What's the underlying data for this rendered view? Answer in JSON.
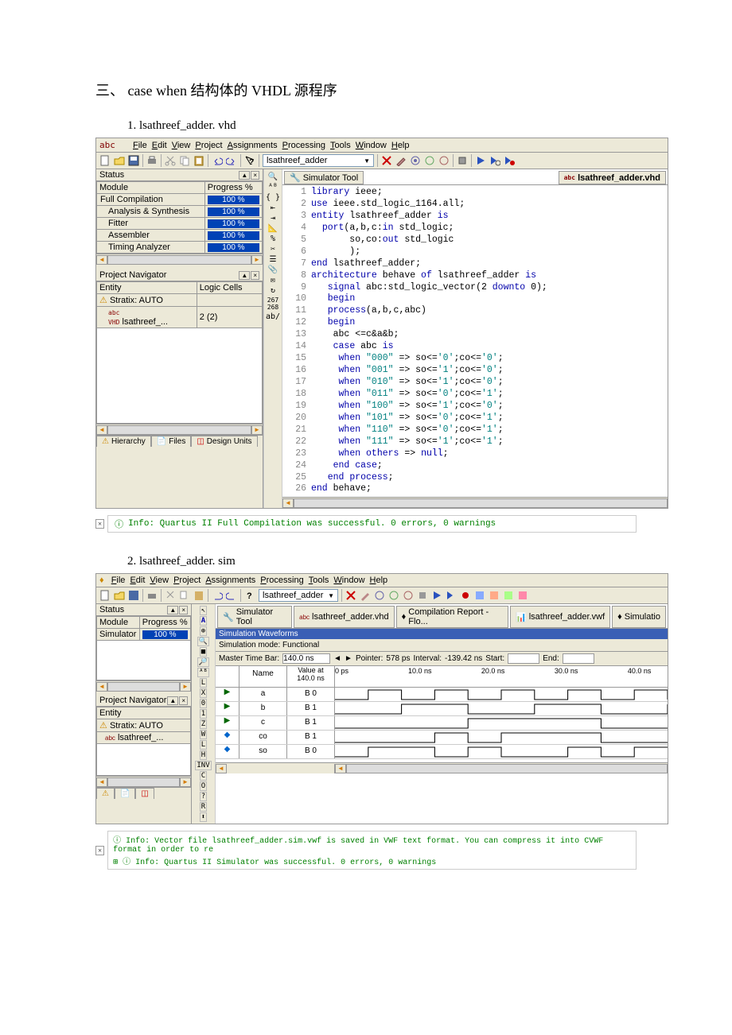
{
  "heading": "三、 case when 结构体的 VHDL 源程序",
  "item1_title": "1.   lsathreef_adder. vhd",
  "item2_title": "2.   lsathreef_adder. sim",
  "menus": [
    "File",
    "Edit",
    "View",
    "Project",
    "Assignments",
    "Processing",
    "Tools",
    "Window",
    "Help"
  ],
  "project_name": "lsathreef_adder",
  "status": {
    "title": "Status",
    "cols": [
      "Module",
      "Progress %"
    ],
    "rows": [
      {
        "name": "Full Compilation",
        "pct": "100 %"
      },
      {
        "name": "Analysis & Synthesis",
        "pct": "100 %"
      },
      {
        "name": "Fitter",
        "pct": "100 %"
      },
      {
        "name": "Assembler",
        "pct": "100 %"
      },
      {
        "name": "Timing Analyzer",
        "pct": "100 %"
      }
    ]
  },
  "nav": {
    "title": "Project Navigator",
    "cols": [
      "Entity",
      "Logic Cells"
    ],
    "rows": [
      {
        "name": "Stratix: AUTO",
        "val": ""
      },
      {
        "name": "lsathreef_...",
        "val": "2 (2)"
      }
    ],
    "tabs": [
      "Hierarchy",
      "Files",
      "Design Units"
    ]
  },
  "doc_tabs": {
    "sim": "Simulator Tool",
    "vhd": "lsathreef_adder.vhd",
    "vwf": "lsathreef_adder.vwf",
    "compile": "Compilation Report - Flo...",
    "simrep": "Simulatio"
  },
  "code_lines": [
    {
      "n": 1,
      "t": "library ieee;",
      "k": [
        "library"
      ]
    },
    {
      "n": 2,
      "t": "use ieee.std_logic_1164.all;",
      "k": [
        "use"
      ]
    },
    {
      "n": 3,
      "t": "entity lsathreef_adder is",
      "k": [
        "entity",
        "is"
      ]
    },
    {
      "n": 4,
      "t": "  port(a,b,c:in std_logic;",
      "k": [
        "port",
        "in"
      ]
    },
    {
      "n": 5,
      "t": "       so,co:out std_logic",
      "k": [
        "out"
      ]
    },
    {
      "n": 6,
      "t": "       );"
    },
    {
      "n": 7,
      "t": "end lsathreef_adder;",
      "k": [
        "end"
      ]
    },
    {
      "n": 8,
      "t": "architecture behave of lsathreef_adder is",
      "k": [
        "architecture",
        "of",
        "is"
      ]
    },
    {
      "n": 9,
      "t": "   signal abc:std_logic_vector(2 downto 0);",
      "k": [
        "signal",
        "downto"
      ]
    },
    {
      "n": 10,
      "t": "   begin",
      "k": [
        "begin"
      ]
    },
    {
      "n": 11,
      "t": "   process(a,b,c,abc)",
      "k": [
        "process"
      ]
    },
    {
      "n": 12,
      "t": "   begin",
      "k": [
        "begin"
      ]
    },
    {
      "n": 13,
      "t": "    abc <=c&a&b;"
    },
    {
      "n": 14,
      "t": "    case abc is",
      "k": [
        "case",
        "is"
      ]
    },
    {
      "n": 15,
      "t": "     when \"000\" => so<='0';co<='0';",
      "k": [
        "when"
      ]
    },
    {
      "n": 16,
      "t": "     when \"001\" => so<='1';co<='0';",
      "k": [
        "when"
      ]
    },
    {
      "n": 17,
      "t": "     when \"010\" => so<='1';co<='0';",
      "k": [
        "when"
      ]
    },
    {
      "n": 18,
      "t": "     when \"011\" => so<='0';co<='1';",
      "k": [
        "when"
      ]
    },
    {
      "n": 19,
      "t": "     when \"100\" => so<='1';co<='0';",
      "k": [
        "when"
      ]
    },
    {
      "n": 20,
      "t": "     when \"101\" => so<='0';co<='1';",
      "k": [
        "when"
      ]
    },
    {
      "n": 21,
      "t": "     when \"110\" => so<='0';co<='1';",
      "k": [
        "when"
      ]
    },
    {
      "n": 22,
      "t": "     when \"111\" => so<='1';co<='1';",
      "k": [
        "when"
      ]
    },
    {
      "n": 23,
      "t": "     when others => null;",
      "k": [
        "when",
        "others",
        "null"
      ]
    },
    {
      "n": 24,
      "t": "    end case;",
      "k": [
        "end",
        "case"
      ]
    },
    {
      "n": 25,
      "t": "   end process;",
      "k": [
        "end",
        "process"
      ]
    },
    {
      "n": 26,
      "t": "end behave;",
      "k": [
        "end"
      ]
    }
  ],
  "info_msg": "Info: Quartus II Full Compilation was successful. 0 errors, 0 warnings",
  "sim": {
    "status_rows": [
      {
        "name": "Simulator",
        "pct": "100 %"
      }
    ],
    "waveform_title": "Simulation Waveforms",
    "mode": "Simulation mode: Functional",
    "timebar": {
      "label": "Master Time Bar:",
      "value": "140.0 ns",
      "pointer_label": "Pointer:",
      "pointer": "578 ps",
      "interval_label": "Interval:",
      "interval": "-139.42 ns",
      "start_label": "Start:",
      "end_label": "End:"
    },
    "val_header": {
      "name": "Name",
      "value": "Value at\n140.0 ns"
    },
    "ticks": [
      "0 ps",
      "10.0 ns",
      "20.0 ns",
      "30.0 ns",
      "40.0 ns"
    ],
    "signals": [
      {
        "name": "a",
        "val": "B 0"
      },
      {
        "name": "b",
        "val": "B 1"
      },
      {
        "name": "c",
        "val": "B 1"
      },
      {
        "name": "co",
        "val": "B 1"
      },
      {
        "name": "so",
        "val": "B 0"
      }
    ],
    "msg1": "Info: Vector file lsathreef_adder.sim.vwf is saved in VWF text format. You can compress it into CVWF format in order to re",
    "msg2": "Info: Quartus II Simulator was successful. 0 errors, 0 warnings"
  }
}
